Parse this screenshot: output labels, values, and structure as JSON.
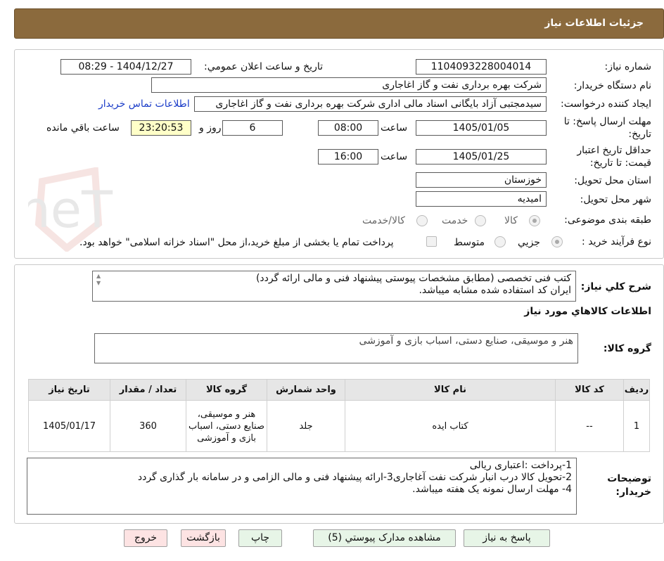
{
  "header": {
    "title": "جزئیات اطلاعات نیاز"
  },
  "form": {
    "need_number_label": "شماره نیاز:",
    "need_number": "1104093228004014",
    "announce_label": "تاریخ و ساعت اعلان عمومي:",
    "announce_value": "1404/12/27 - 08:29",
    "buyer_org_label": "نام دستگاه خريدار:",
    "buyer_org": "شرکت بهره برداری نفت و گاز اغاجاری",
    "creator_label": "ايجاد کننده درخواست:",
    "creator": "سیدمجتبی آزاد بایگانی اسناد مالی اداری شرکت بهره برداری نفت و گاز اغاجاری",
    "contact_link": "اطلاعات تماس خريدار",
    "deadline_label_1": "مهلت ارسال پاسخ: تا",
    "deadline_label_2": "تاریخ:",
    "deadline_date": "1405/01/05",
    "time_label": "ساعت",
    "deadline_time": "08:00",
    "days_value": "6",
    "days_label": "روز و",
    "remaining_time": "23:20:53",
    "remaining_label": "ساعت باقي مانده",
    "validity_label_1": "حداقل تاريخ اعتبار",
    "validity_label_2": "قيمت: تا تاريخ:",
    "validity_date": "1405/01/25",
    "validity_time": "16:00",
    "province_label": "استان محل تحويل:",
    "province": "خوزستان",
    "city_label": "شهر محل تحويل:",
    "city": "امیدیه",
    "category_label": "طبقه بندی موضوعی:",
    "category_options": [
      "کالا",
      "خدمت",
      "کالا/خدمت"
    ],
    "process_label": "نوع فرآیند خرید :",
    "process_options": [
      "جزيي",
      "متوسط"
    ],
    "payment_note": "پرداخت تمام یا بخشی از مبلغ خرید،از محل \"اسناد خزانه اسلامی\" خواهد بود."
  },
  "description": {
    "label": "شرح کلي نياز:",
    "line1": "کتب فنی تخصصی (مطابق مشخصات پیوستی پیشنهاد فنی و مالی ارائه گردد)",
    "line2": "ایران کد استفاده شده مشابه میباشد."
  },
  "goods": {
    "section_title": "اطلاعات کالاهاي مورد نياز",
    "group_label": "گروه کالا:",
    "group_value": "هنر و موسیقی، صنایع دستی، اسباب بازی و آموزشی"
  },
  "table": {
    "headers": [
      "رديف",
      "کد کالا",
      "نام کالا",
      "واحد شمارش",
      "گروه کالا",
      "تعداد / مقدار",
      "تاريخ نياز"
    ],
    "rows": [
      {
        "row": "1",
        "code": "--",
        "name": "کتاب ایده",
        "unit": "جلد",
        "group": "هنر و موسیقی، صنایع دستی، اسباب بازی و آموزشی",
        "qty": "360",
        "date": "1405/01/17"
      }
    ]
  },
  "buyer_notes": {
    "label_1": "توضيحات",
    "label_2": "خريدار:",
    "line1": "1-پرداخت :اعتباری ریالی",
    "line2": "2-تحویل کالا درب انبار شرکت نفت آغاجاری3-ارائه پیشنهاد فنی و مالی الزامی و در سامانه بار گذاری گردد",
    "line3": "4- مهلت ارسال نمونه یک هفته میباشد."
  },
  "buttons": {
    "reply": "پاسخ به نياز",
    "attachments": "مشاهده مدارک پيوستي (5)",
    "print": "چاپ",
    "back": "بازگشت",
    "exit": "خروج"
  },
  "watermark": {
    "text": "AriaTender.neT"
  },
  "colors": {
    "header": "#8b6a3d",
    "link": "#1a3cc8",
    "remaining_bg": "#ffffc8",
    "button_bg": "#e7f5e7",
    "button_red_bg": "#fde3e3"
  }
}
